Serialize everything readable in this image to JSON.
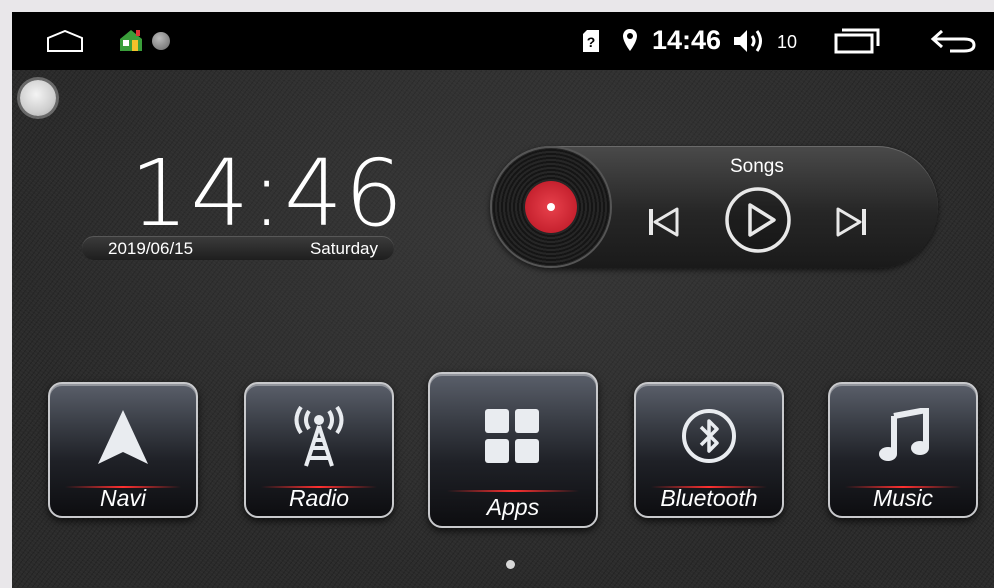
{
  "status_bar": {
    "time": "14:46",
    "volume": "10"
  },
  "clock": {
    "time": "14:46",
    "date": "2019/06/15",
    "day": "Saturday"
  },
  "player": {
    "title": "Songs"
  },
  "tiles": [
    {
      "label": "Navi",
      "icon": "navigation-arrow-icon"
    },
    {
      "label": "Radio",
      "icon": "radio-tower-icon"
    },
    {
      "label": "Apps",
      "icon": "apps-grid-icon"
    },
    {
      "label": "Bluetooth",
      "icon": "bluetooth-icon"
    },
    {
      "label": "Music",
      "icon": "music-note-icon"
    }
  ],
  "colors": {
    "accent_red": "#e03038",
    "status_bar_bg": "#000000",
    "tile_border": "#c8c9cc"
  },
  "pager": {
    "current_page": 1,
    "total_pages": 1
  }
}
